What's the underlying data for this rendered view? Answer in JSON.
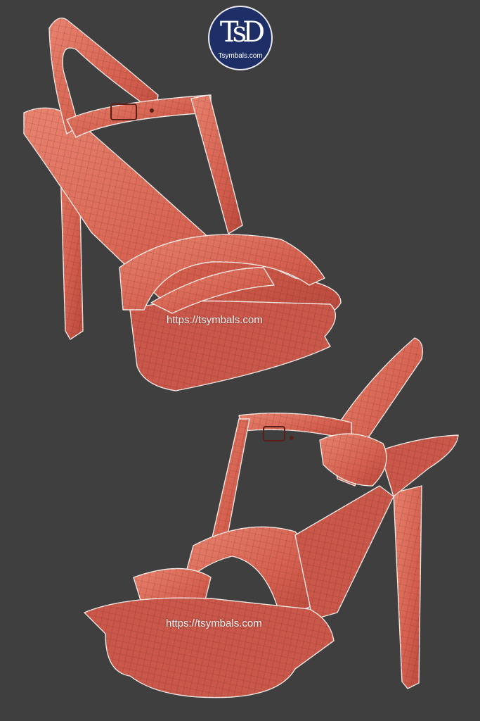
{
  "logo": {
    "monogram": "TsD",
    "text": "Tsymbals.com"
  },
  "watermarks": [
    "https://tsymbals.com",
    "https://tsymbals.com"
  ],
  "colors": {
    "background": "#3f3f3f",
    "shoe": "#d9685a",
    "wire": "#4a1a16",
    "logo_bg": "#1d2f66"
  }
}
